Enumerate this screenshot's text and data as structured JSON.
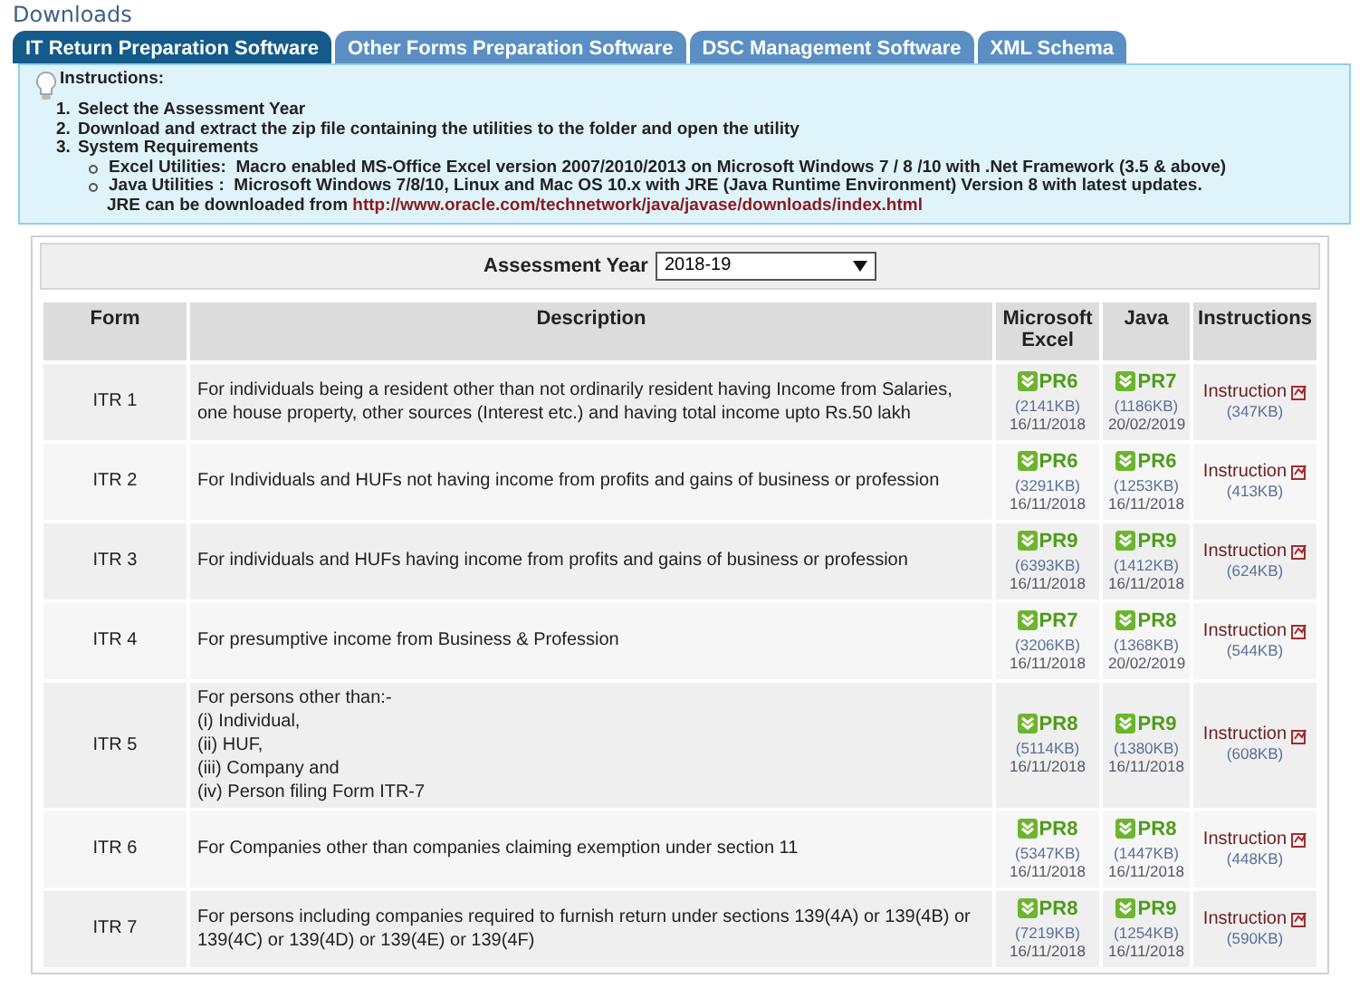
{
  "page_title": "Downloads",
  "tabs": [
    {
      "label": "IT Return Preparation Software",
      "selected": true
    },
    {
      "label": "Other Forms Preparation Software",
      "selected": false
    },
    {
      "label": "DSC Management Software",
      "selected": false
    },
    {
      "label": "XML Schema",
      "selected": false
    }
  ],
  "instructions": {
    "title": "Instructions:",
    "steps": [
      {
        "number": "1.",
        "text": "Select the Assessment Year"
      },
      {
        "number": "2.",
        "text": "Download and extract the zip file containing the utilities to the folder and open the utility"
      },
      {
        "number": "3.",
        "text": "System Requirements"
      }
    ],
    "requirements": [
      {
        "text": "Excel Utilities:  Macro enabled MS-Office Excel version 2007/2010/2013 on Microsoft Windows 7 / 8 /10 with .Net Framework (3.5 & above)"
      },
      {
        "text": "Java Utilities :  Microsoft Windows 7/8/10, Linux and Mac OS 10.x with JRE (Java Runtime Environment) Version 8 with latest updates.",
        "note": "JRE can be downloaded from",
        "link": "http://www.oracle.com/technetwork/java/javase/downloads/index.html"
      }
    ]
  },
  "assessment_year": {
    "label": "Assessment Year",
    "value": "2018-19"
  },
  "table": {
    "columns": [
      "Form",
      "Description",
      "Microsoft Excel",
      "Java",
      "Instructions"
    ],
    "rows": [
      {
        "form": "ITR 1",
        "description": "For individuals being a resident other than not ordinarily resident having Income from Salaries, one house property, other sources (Interest etc.) and having total income upto Rs.50 lakh",
        "excel": {
          "label": "PR6",
          "size": "(2141KB)",
          "date": "16/11/2018"
        },
        "java": {
          "label": "PR7",
          "size": "(1186KB)",
          "date": "20/02/2019"
        },
        "instruction": {
          "label": "Instruction",
          "size": "(347KB)"
        }
      },
      {
        "form": "ITR 2",
        "description": "For Individuals and HUFs not having income from profits and gains of business or profession",
        "excel": {
          "label": "PR6",
          "size": "(3291KB)",
          "date": "16/11/2018"
        },
        "java": {
          "label": "PR6",
          "size": "(1253KB)",
          "date": "16/11/2018"
        },
        "instruction": {
          "label": "Instruction",
          "size": "(413KB)"
        }
      },
      {
        "form": "ITR 3",
        "description": "For individuals and HUFs having income from profits and gains of business or profession",
        "excel": {
          "label": "PR9",
          "size": "(6393KB)",
          "date": "16/11/2018"
        },
        "java": {
          "label": "PR9",
          "size": "(1412KB)",
          "date": "16/11/2018"
        },
        "instruction": {
          "label": "Instruction",
          "size": "(624KB)"
        }
      },
      {
        "form": "ITR 4",
        "description": "For presumptive income from Business & Profession",
        "excel": {
          "label": "PR7",
          "size": "(3206KB)",
          "date": "16/11/2018"
        },
        "java": {
          "label": "PR8",
          "size": "(1368KB)",
          "date": "20/02/2019"
        },
        "instruction": {
          "label": "Instruction",
          "size": "(544KB)"
        }
      },
      {
        "form": "ITR 5",
        "description": "For persons other than:-\n(i) Individual,\n(ii) HUF,\n(iii) Company and\n(iv) Person filing Form ITR-7",
        "excel": {
          "label": "PR8",
          "size": "(5114KB)",
          "date": "16/11/2018"
        },
        "java": {
          "label": "PR9",
          "size": "(1380KB)",
          "date": "16/11/2018"
        },
        "instruction": {
          "label": "Instruction",
          "size": "(608KB)"
        }
      },
      {
        "form": "ITR 6",
        "description": "For Companies other than companies claiming exemption under section 11",
        "excel": {
          "label": "PR8",
          "size": "(5347KB)",
          "date": "16/11/2018"
        },
        "java": {
          "label": "PR8",
          "size": "(1447KB)",
          "date": "16/11/2018"
        },
        "instruction": {
          "label": "Instruction",
          "size": "(448KB)"
        }
      },
      {
        "form": "ITR 7",
        "description": "For persons including companies required to furnish return under sections 139(4A) or 139(4B) or 139(4C) or 139(4D) or 139(4E) or 139(4F)",
        "excel": {
          "label": "PR8",
          "size": "(7219KB)",
          "date": "16/11/2018"
        },
        "java": {
          "label": "PR9",
          "size": "(1254KB)",
          "date": "16/11/2018"
        },
        "instruction": {
          "label": "Instruction",
          "size": "(590KB)"
        }
      }
    ]
  }
}
